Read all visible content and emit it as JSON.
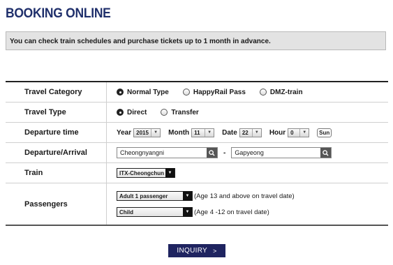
{
  "page": {
    "title": "BOOKING ONLINE",
    "notice": "You can check train schedules and purchase tickets up to 1 month in advance."
  },
  "form": {
    "travel_category": {
      "label": "Travel Category",
      "options": [
        "Normal Type",
        "HappyRail Pass",
        "DMZ-train"
      ],
      "selected": "Normal Type"
    },
    "travel_type": {
      "label": "Travel Type",
      "options": [
        "Direct",
        "Transfer"
      ],
      "selected": "Direct"
    },
    "departure_time": {
      "label": "Departure time",
      "year_label": "Year",
      "year": "2015",
      "month_label": "Month",
      "month": "11",
      "date_label": "Date",
      "date": "22",
      "hour_label": "Hour",
      "hour": "0",
      "weekday": "Sun"
    },
    "departure_arrival": {
      "label": "Departure/Arrival",
      "departure": "Cheongnyangni",
      "separator": "-",
      "arrival": "Gapyeong"
    },
    "train": {
      "label": "Train",
      "selected": "ITX-Cheongchun"
    },
    "passengers": {
      "label": "Passengers",
      "adult": {
        "selected": "Adult 1 passenger",
        "note": "(Age 13 and above on travel date)"
      },
      "child": {
        "selected": "Child",
        "note": "(Age 4 -12 on travel date)"
      }
    }
  },
  "actions": {
    "inquiry_label": "INQUIRY"
  },
  "icons": {
    "radio": "radio-icon",
    "dropdown": "chevron-down-icon",
    "search": "search-icon",
    "next": "chevron-right-icon"
  },
  "colors": {
    "title": "#1f2f6b",
    "button": "#1f2460",
    "notice_bg": "#e3e3e3"
  }
}
